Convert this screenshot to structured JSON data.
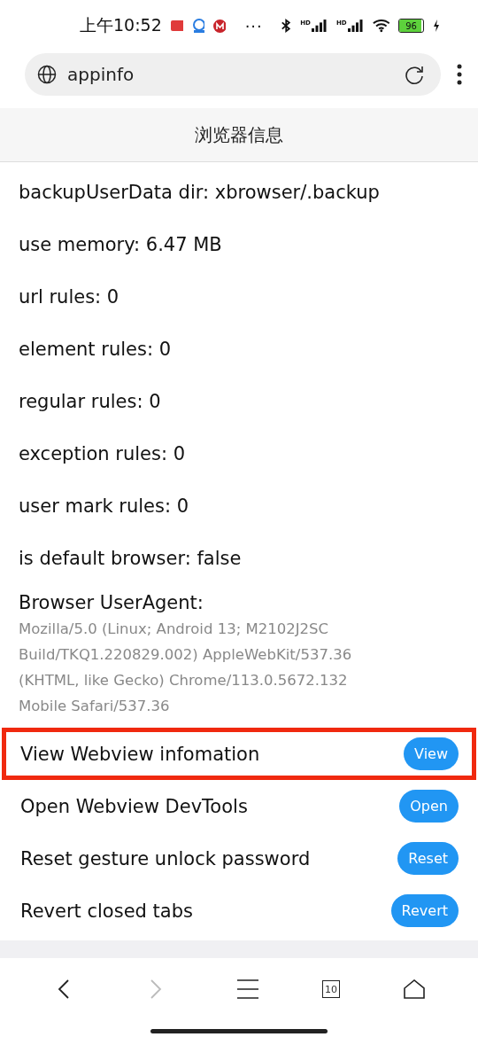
{
  "status_bar": {
    "time": "上午10:52",
    "more": "···",
    "signals": [
      "HD",
      "HD"
    ],
    "battery": "96"
  },
  "address_bar": {
    "url": "appinfo"
  },
  "header": {
    "title": "浏览器信息"
  },
  "info_rows": [
    {
      "text": "backupUserData dir: xbrowser/.backup"
    },
    {
      "text": "use memory: 6.47 MB"
    },
    {
      "text": "url rules: 0"
    },
    {
      "text": "element rules: 0"
    },
    {
      "text": "regular rules: 0"
    },
    {
      "text": "exception rules: 0"
    },
    {
      "text": "user mark rules: 0"
    },
    {
      "text": "is default browser: false"
    }
  ],
  "user_agent": {
    "label": "Browser UserAgent:",
    "lines": [
      "Mozilla/5.0 (Linux; Android 13; M2102J2SC",
      "Build/TKQ1.220829.002) AppleWebKit/537.36",
      "(KHTML, like Gecko) Chrome/113.0.5672.132",
      "Mobile Safari/537.36"
    ]
  },
  "actions": [
    {
      "label": "View Webview infomation",
      "button": "View",
      "highlighted": true
    },
    {
      "label": "Open Webview DevTools",
      "button": "Open",
      "highlighted": false
    },
    {
      "label": "Reset gesture unlock password",
      "button": "Reset",
      "highlighted": false
    },
    {
      "label": "Revert closed tabs",
      "button": "Revert",
      "highlighted": false
    }
  ],
  "bottom_nav": {
    "forward_disabled": true,
    "tab_count": "10"
  }
}
